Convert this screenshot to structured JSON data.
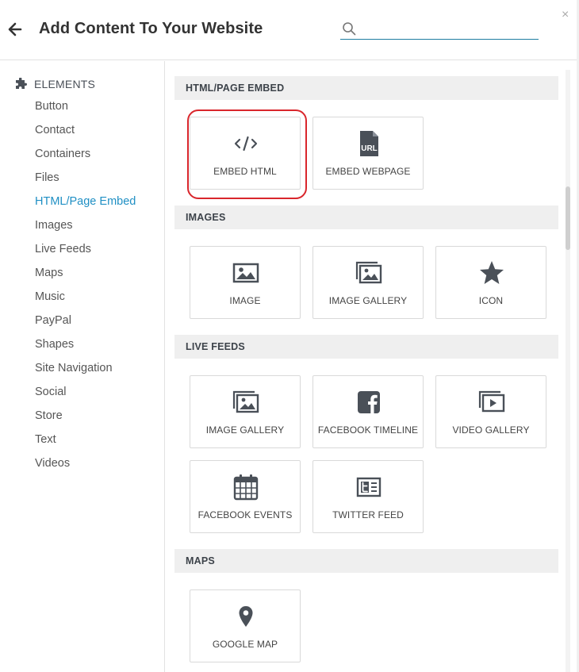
{
  "header": {
    "title": "Add Content To Your Website",
    "search_placeholder": "",
    "search_value": "",
    "close_label": "×"
  },
  "sidebar": {
    "heading": "ELEMENTS",
    "active": "HTML/Page Embed",
    "items": [
      {
        "label": "Button"
      },
      {
        "label": "Contact"
      },
      {
        "label": "Containers"
      },
      {
        "label": "Files"
      },
      {
        "label": "HTML/Page Embed"
      },
      {
        "label": "Images"
      },
      {
        "label": "Live Feeds"
      },
      {
        "label": "Maps"
      },
      {
        "label": "Music"
      },
      {
        "label": "PayPal"
      },
      {
        "label": "Shapes"
      },
      {
        "label": "Site Navigation"
      },
      {
        "label": "Social"
      },
      {
        "label": "Store"
      },
      {
        "label": "Text"
      },
      {
        "label": "Videos"
      }
    ]
  },
  "sections": [
    {
      "title": "HTML/PAGE EMBED",
      "tiles": [
        {
          "label": "EMBED HTML",
          "icon": "code-icon",
          "highlighted": true
        },
        {
          "label": "EMBED WEBPAGE",
          "icon": "url-file-icon"
        }
      ]
    },
    {
      "title": "IMAGES",
      "tiles": [
        {
          "label": "IMAGE",
          "icon": "image-icon"
        },
        {
          "label": "IMAGE GALLERY",
          "icon": "image-gallery-icon"
        },
        {
          "label": "ICON",
          "icon": "star-icon"
        }
      ]
    },
    {
      "title": "LIVE FEEDS",
      "tiles": [
        {
          "label": "IMAGE GALLERY",
          "icon": "image-gallery-icon"
        },
        {
          "label": "FACEBOOK TIMELINE",
          "icon": "facebook-icon"
        },
        {
          "label": "VIDEO GALLERY",
          "icon": "video-gallery-icon"
        },
        {
          "label": "FACEBOOK EVENTS",
          "icon": "calendar-icon"
        },
        {
          "label": "TWITTER FEED",
          "icon": "twitter-feed-icon"
        }
      ]
    },
    {
      "title": "MAPS",
      "tiles": [
        {
          "label": "GOOGLE MAP",
          "icon": "map-pin-icon"
        }
      ]
    }
  ],
  "colors": {
    "accent": "#1f8fc4",
    "highlight": "#d9262c",
    "icon": "#4a5058"
  }
}
